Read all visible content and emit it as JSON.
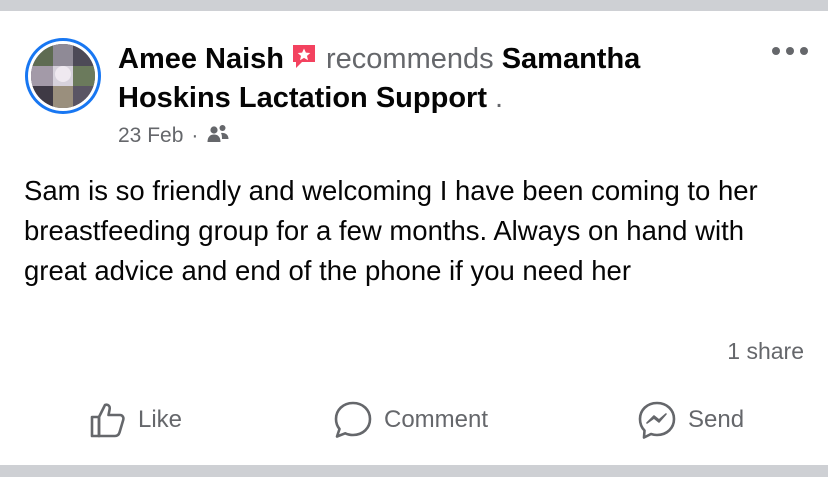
{
  "post": {
    "author": "Amee Naish",
    "verb": "recommends",
    "page_line1": "Samantha",
    "page_line2": "Hoskins Lactation Support",
    "page_trailing": ".",
    "date": "23 Feb",
    "separator": "·",
    "audience_icon": "friends-icon",
    "text": "Sam is so friendly and welcoming I have been coming to her breastfeeding group for a few months. Always on hand with great advice and end of the phone if you need her",
    "shares": "1 share"
  },
  "actions": {
    "like": "Like",
    "comment": "Comment",
    "send": "Send"
  },
  "colors": {
    "accent": "#1877f2",
    "recommend_badge": "#f3425f",
    "secondary_text": "#65676b",
    "primary_text": "#050505",
    "divider": "#ced0d4"
  }
}
